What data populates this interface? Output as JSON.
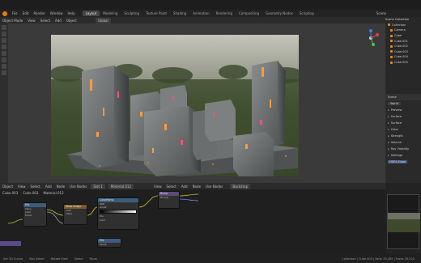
{
  "menu": {
    "items": [
      "File",
      "Edit",
      "Render",
      "Window",
      "Help"
    ],
    "workspaces": [
      "Layout",
      "Modeling",
      "Sculpting",
      "Texture Paint",
      "Shading",
      "Animation",
      "Rendering",
      "Compositing",
      "Geometry Nodes",
      "Scripting"
    ],
    "active_workspace": "Layout",
    "scene_label": "Scene"
  },
  "viewport": {
    "header": [
      "Object Mode",
      "View",
      "Select",
      "Add",
      "Object"
    ],
    "orientation": "Global"
  },
  "outliner": {
    "title": "Scene Collection",
    "rows": [
      "Collection",
      "Camera",
      "Cube",
      "Cube.001",
      "Cube.002",
      "Cube.003",
      "Cube.004",
      "Cube.005"
    ]
  },
  "properties": {
    "scene_label": "Scene",
    "world_label": "World",
    "panels": [
      "Preview",
      "Surface",
      "Surface",
      "Color",
      "Strength",
      "Volume",
      "Ray Visibility",
      "Settings"
    ],
    "hdri_label": "HDRI_Klopp"
  },
  "shader": {
    "header": [
      "Object",
      "View",
      "Select",
      "Add",
      "Node",
      "Use Nodes"
    ],
    "slot": "Slot 1",
    "material": "Material.012",
    "breadcrumb": [
      "Cube.003",
      "Cube.003",
      "Material.012"
    ],
    "right_header": [
      "View",
      "Select",
      "Add",
      "Node",
      "Use Nodes"
    ],
    "right_image": "Backdrop",
    "nodes": [
      {
        "title": "Mix",
        "rows": [
          "Value",
          "Color",
          "Factor"
        ]
      },
      {
        "title": "Wrap Image",
        "rows": [
          "Color",
          "Alpha"
        ]
      },
      {
        "title": "ColorRamp",
        "rows": [
          "RGB",
          "Linear",
          "Pos",
          "Color"
        ]
      },
      {
        "title": "Bump",
        "rows": [
          "Normal"
        ]
      },
      {
        "title": "Mix",
        "rows": [
          "Result"
        ]
      }
    ]
  },
  "status": {
    "items": [
      "Set 3D Cursor",
      "Box Select",
      "Rotate View",
      "Select",
      "Move"
    ],
    "right": "Collection | Cube.003 | Verts 33,465 | Faces 33,520"
  },
  "colors": {
    "accent": "#e87d0d",
    "active_tab": "#454545",
    "emission": "#ff9a3c",
    "emission_pink": "#ff4f7a"
  }
}
